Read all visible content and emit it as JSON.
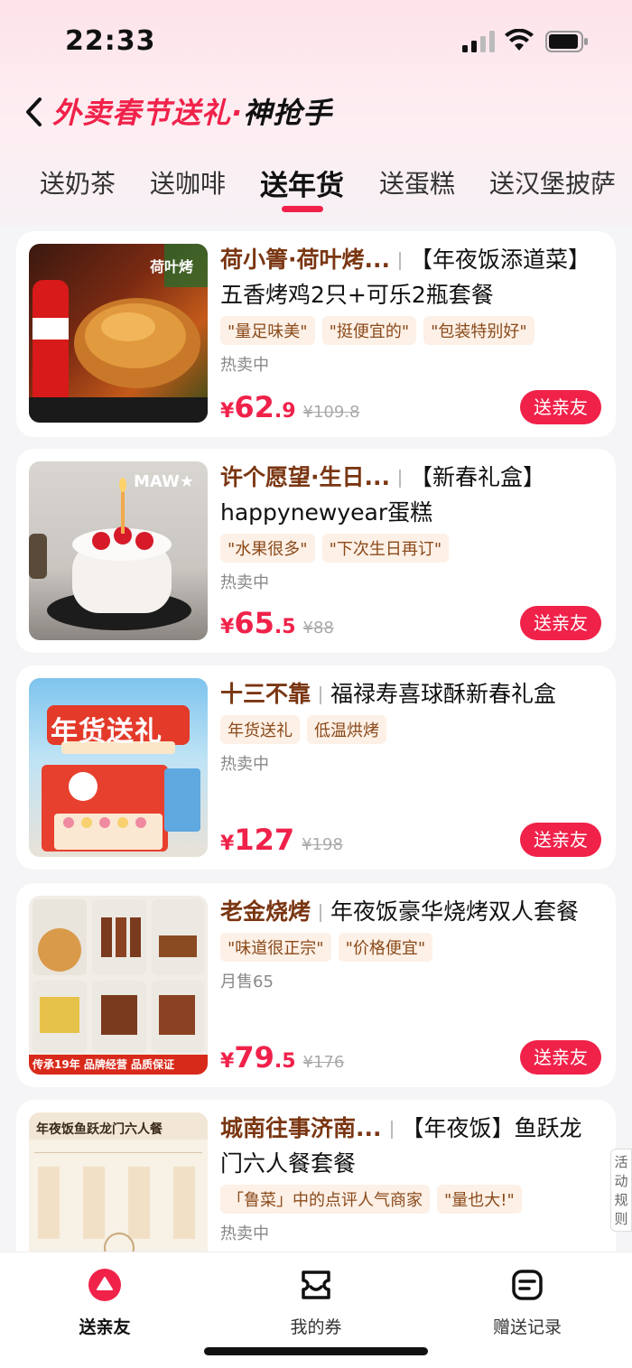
{
  "status": {
    "time": "22:33"
  },
  "header": {
    "title_main": "外卖春节送礼",
    "title_dot": "·",
    "title_sub": "神抢手"
  },
  "tabs": [
    {
      "label": "送奶茶"
    },
    {
      "label": "送咖啡"
    },
    {
      "label": "送年货"
    },
    {
      "label": "送蛋糕"
    },
    {
      "label": "送汉堡披萨"
    }
  ],
  "colors": {
    "accent": "#f0224a",
    "shop_name": "#7a3612",
    "tag_bg": "#fdf0e6"
  },
  "products": [
    {
      "shop": "荷小箐·荷叶烤...",
      "title": "【年夜饭添道菜】五香烤鸡2只+可乐2瓶套餐",
      "tags": [
        "\"量足味美\"",
        "\"挺便宜的\"",
        "\"包装特别好\""
      ],
      "sales": "热卖中",
      "price_int": "62",
      "price_dec": ".9",
      "orig_price": "¥109.8",
      "button": "送亲友",
      "thumb_text": "荷叶烤"
    },
    {
      "shop": "许个愿望·生日...",
      "title": "【新春礼盒】happynewyear蛋糕",
      "tags": [
        "\"水果很多\"",
        "\"下次生日再订\""
      ],
      "sales": "热卖中",
      "price_int": "65",
      "price_dec": ".5",
      "orig_price": "¥88",
      "button": "送亲友",
      "thumb_text": "MAW★"
    },
    {
      "shop": "十三不靠",
      "title": "福禄寿喜球酥新春礼盒",
      "tags": [
        "年货送礼",
        "低温烘烤"
      ],
      "sales": "热卖中",
      "price_int": "127",
      "price_dec": "",
      "orig_price": "¥198",
      "button": "送亲友",
      "thumb_text": "年货送礼"
    },
    {
      "shop": "老金烧烤",
      "title": "年夜饭豪华烧烤双人套餐",
      "tags": [
        "\"味道很正宗\"",
        "\"价格便宜\""
      ],
      "sales": "月售65",
      "price_int": "79",
      "price_dec": ".5",
      "orig_price": "¥176",
      "button": "送亲友",
      "thumb_text": "传承19年 品牌经营 品质保证"
    },
    {
      "shop": "城南往事济南...",
      "title": "【年夜饭】鱼跃龙门六人餐套餐",
      "tags": [
        "「鲁菜」中的点评人气商家",
        "\"量也大!\""
      ],
      "sales": "热卖中",
      "price_int": "",
      "price_dec": "",
      "orig_price": "",
      "button": "",
      "thumb_text": "年夜饭鱼跃龙门六人餐"
    }
  ],
  "price_symbol": "¥",
  "side_rules": "活动规则",
  "bottom_nav": [
    {
      "label": "送亲友",
      "icon": "triangle-icon"
    },
    {
      "label": "我的券",
      "icon": "ticket-icon"
    },
    {
      "label": "赠送记录",
      "icon": "record-icon"
    }
  ]
}
